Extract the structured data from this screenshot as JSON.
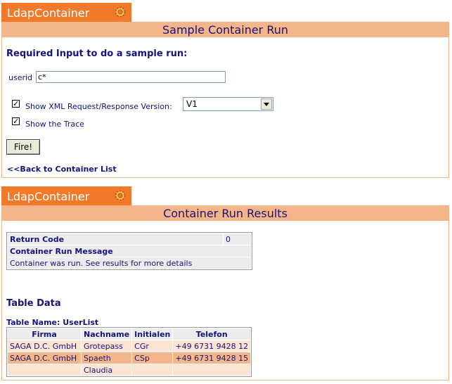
{
  "tab1": {
    "label": "LdapContainer"
  },
  "panel1": {
    "title": "Sample Container Run",
    "heading": "Required Input to do a sample run:",
    "userid_label": "userid",
    "userid_value": "c*",
    "show_xml_label": "Show XML Request/Response Version:",
    "show_xml_checked": "✓",
    "version_selected": "V1",
    "show_trace_label": "Show the Trace",
    "show_trace_checked": "✓",
    "fire_button": "Fire!",
    "back_link": "<<Back to Container List"
  },
  "tab2": {
    "label": "LdapContainer"
  },
  "panel2": {
    "title": "Container Run Results",
    "return_code_label": "Return Code",
    "return_code_value": "0",
    "run_message_label": "Container Run Message",
    "run_message_value": "Container was run. See results for more details",
    "table_data_heading": "Table Data",
    "table_name_label": "Table Name: UserList",
    "columns": [
      "Firma",
      "Nachname",
      "Initialen",
      "Telefon"
    ],
    "rows": [
      [
        "SAGA D.C. GmbH",
        "Grotepass",
        "CGr",
        "+49 6731 9428 12"
      ],
      [
        "SAGA D.C. GmbH",
        "Spaeth",
        "CSp",
        "+49 6731 9428 15"
      ],
      [
        "",
        "Claudia",
        "",
        ""
      ]
    ]
  },
  "colors": {
    "tab_orange": "#f07a2a",
    "header_peach": "#f5b58a",
    "text_navy": "#14147a"
  },
  "icons": {
    "tab_icon": "gear-icon"
  }
}
